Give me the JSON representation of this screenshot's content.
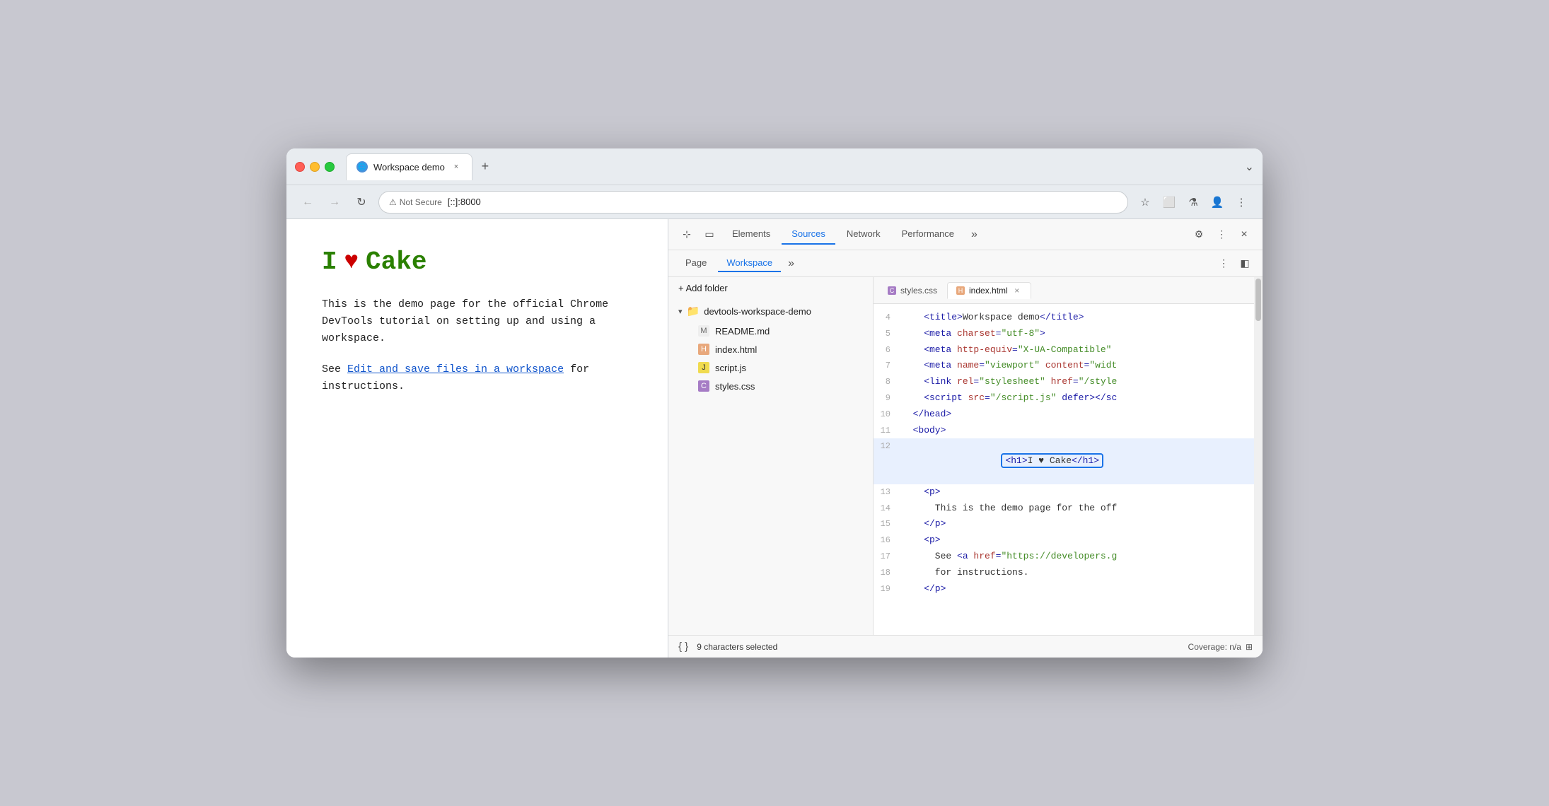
{
  "browser": {
    "tab_title": "Workspace demo",
    "tab_close": "×",
    "new_tab": "+",
    "chevron_down": "⌄",
    "nav_back": "←",
    "nav_forward": "→",
    "nav_refresh": "↻",
    "security_label": "Not Secure",
    "address": "[::]:8000",
    "star_icon": "☆",
    "extension_icon": "⬜",
    "lab_icon": "⚗",
    "profile_icon": "👤",
    "more_icon": "⋮"
  },
  "page": {
    "heading_green": "I",
    "heading_heart": "♥",
    "heading_cake": "Cake",
    "body_text_1": "This is the demo page for the official Chrome DevTools tutorial on setting up and using a workspace.",
    "body_text_2_prefix": "See ",
    "body_link_text": "Edit and save files in a workspace",
    "body_text_2_suffix": " for instructions."
  },
  "devtools": {
    "toolbar": {
      "inspect_icon": "⊹",
      "device_icon": "▭",
      "tab_elements": "Elements",
      "tab_sources": "Sources",
      "tab_network": "Network",
      "tab_performance": "Performance",
      "more_tabs": "»",
      "settings_icon": "⚙",
      "more_icon": "⋮",
      "close_icon": "×"
    },
    "sources": {
      "tab_page": "Page",
      "tab_workspace": "Workspace",
      "more_tabs": "»",
      "more_icon": "⋮",
      "sidebar_icon": "◧",
      "add_folder_label": "+ Add folder",
      "folder_name": "devtools-workspace-demo",
      "files": [
        {
          "name": "README.md",
          "type": "md"
        },
        {
          "name": "index.html",
          "type": "html"
        },
        {
          "name": "script.js",
          "type": "js"
        },
        {
          "name": "styles.css",
          "type": "css"
        }
      ],
      "editor_tabs": [
        {
          "name": "styles.css",
          "type": "css",
          "active": false
        },
        {
          "name": "index.html",
          "type": "html",
          "active": true,
          "close": "×"
        }
      ]
    },
    "code_lines": [
      {
        "num": "4",
        "content": "    <title>Workspace demo</title>",
        "highlight": false
      },
      {
        "num": "5",
        "content": "    <meta charset=\"utf-8\">",
        "highlight": false
      },
      {
        "num": "6",
        "content": "    <meta http-equiv=\"X-UA-Compatible\"",
        "highlight": false
      },
      {
        "num": "7",
        "content": "    <meta name=\"viewport\" content=\"widt",
        "highlight": false
      },
      {
        "num": "8",
        "content": "    <link rel=\"stylesheet\" href=\"/style",
        "highlight": false
      },
      {
        "num": "9",
        "content": "    <script src=\"/script.js\" defer></sc",
        "highlight": false
      },
      {
        "num": "10",
        "content": "  </head>",
        "highlight": false
      },
      {
        "num": "11",
        "content": "  <body>",
        "highlight": false
      },
      {
        "num": "12",
        "content": "    <h1>I ♥ Cake</h1>",
        "highlight": true
      },
      {
        "num": "13",
        "content": "    <p>",
        "highlight": false
      },
      {
        "num": "14",
        "content": "      This is the demo page for the off",
        "highlight": false
      },
      {
        "num": "15",
        "content": "    </p>",
        "highlight": false
      },
      {
        "num": "16",
        "content": "    <p>",
        "highlight": false
      },
      {
        "num": "17",
        "content": "      See <a href=\"https://developers.g",
        "highlight": false
      },
      {
        "num": "18",
        "content": "      for instructions.",
        "highlight": false
      },
      {
        "num": "19",
        "content": "    </p>",
        "highlight": false
      }
    ],
    "statusbar": {
      "curly_braces": "{ }",
      "selected_text": "9 characters selected",
      "coverage_label": "Coverage: n/a",
      "screenshot_icon": "⊞"
    }
  }
}
